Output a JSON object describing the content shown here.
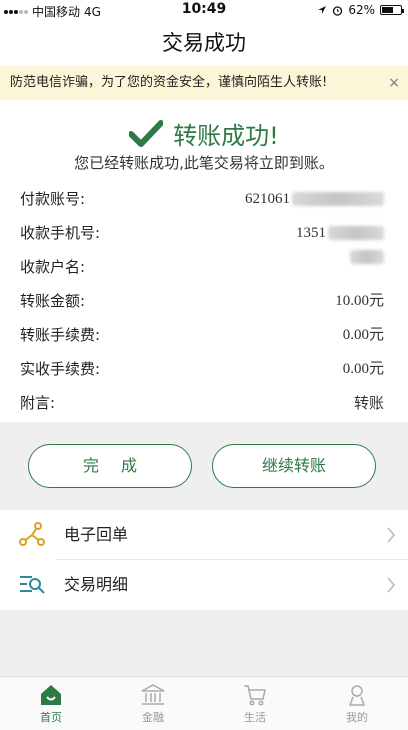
{
  "status_bar": {
    "carrier": "中国移动",
    "network": "4G",
    "time": "10:49",
    "battery": "62%",
    "battery_level": 0.62
  },
  "header": {
    "title": "交易成功"
  },
  "warning": {
    "text": "防范电信诈骗，为了您的资金安全，谨慎向陌生人转账!",
    "close_label": "×"
  },
  "success": {
    "title": "转账成功!",
    "description": "您已经转账成功,此笔交易将立即到账。"
  },
  "details": [
    {
      "label": "付款账号:",
      "value": "621061",
      "masked": true
    },
    {
      "label": "收款手机号:",
      "value": "1351",
      "masked": true
    },
    {
      "label": "收款户名:",
      "value": "",
      "masked": true
    },
    {
      "label": "转账金额:",
      "value": "10.00元",
      "masked": false
    },
    {
      "label": "转账手续费:",
      "value": "0.00元",
      "masked": false
    },
    {
      "label": "实收手续费:",
      "value": "0.00元",
      "masked": false
    },
    {
      "label": "附言:",
      "value": "转账",
      "masked": false
    }
  ],
  "actions": {
    "done": "完成",
    "continue": "继续转账"
  },
  "menu": [
    {
      "label": "电子回单",
      "icon": "share-nodes-icon"
    },
    {
      "label": "交易明细",
      "icon": "list-search-icon"
    }
  ],
  "tabbar": [
    {
      "label": "首页",
      "icon": "home-icon",
      "active": true
    },
    {
      "label": "金融",
      "icon": "bank-icon",
      "active": false
    },
    {
      "label": "生活",
      "icon": "cart-icon",
      "active": false
    },
    {
      "label": "我的",
      "icon": "user-icon",
      "active": false
    }
  ],
  "colors": {
    "accent": "#2e7a46",
    "warning_bg": "#fcf6d8",
    "background": "#efefef"
  }
}
